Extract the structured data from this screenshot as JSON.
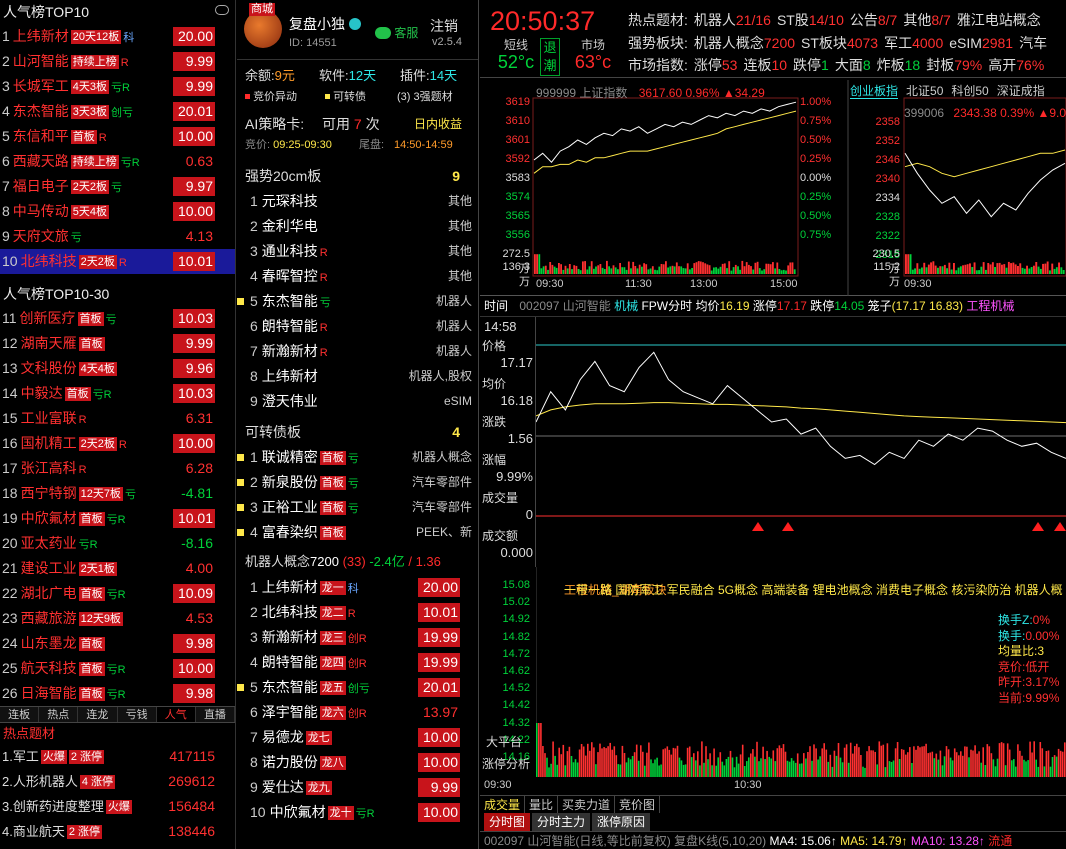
{
  "top10": {
    "title": "人气榜TOP10",
    "rows": [
      {
        "n": "1",
        "name": "上纬新材",
        "tags": [
          "20天12板"
        ],
        "mark": "科",
        "mark_color": "blue",
        "val": "20.00",
        "bg": true
      },
      {
        "n": "2",
        "name": "山河智能",
        "tags": [
          "持续上榜"
        ],
        "mark": "R",
        "mark_color": "red",
        "val": "9.99",
        "bg": true
      },
      {
        "n": "3",
        "name": "长城军工",
        "tags": [
          "4天3板"
        ],
        "mark": "亏R",
        "mark_color": "green",
        "val": "9.99",
        "bg": true
      },
      {
        "n": "4",
        "name": "东杰智能",
        "tags": [
          "3天3板"
        ],
        "mark": "创亏",
        "mark_color": "green",
        "val": "20.01",
        "bg": true
      },
      {
        "n": "5",
        "name": "东信和平",
        "tags": [
          "首板"
        ],
        "mark": "R",
        "mark_color": "red",
        "val": "10.00",
        "bg": true
      },
      {
        "n": "6",
        "name": "西藏天路",
        "tags": [
          "持续上榜"
        ],
        "mark": "亏R",
        "mark_color": "green",
        "val": "0.63",
        "bg": false
      },
      {
        "n": "7",
        "name": "福日电子",
        "tags": [
          "2天2板"
        ],
        "mark": "亏",
        "mark_color": "green",
        "val": "9.97",
        "bg": true
      },
      {
        "n": "8",
        "name": "中马传动",
        "tags": [
          "5天4板"
        ],
        "mark": "",
        "mark_color": "",
        "val": "10.00",
        "bg": true
      },
      {
        "n": "9",
        "name": "天府文旅",
        "tags": [],
        "mark": "亏",
        "mark_color": "green",
        "val": "4.13",
        "bg": false
      },
      {
        "n": "10",
        "name": "北纬科技",
        "tags": [
          "2天2板"
        ],
        "mark": "R",
        "mark_color": "red",
        "val": "10.01",
        "bg": true,
        "sel": true
      }
    ]
  },
  "top30": {
    "title": "人气榜TOP10-30",
    "rows": [
      {
        "n": "11",
        "name": "创新医疗",
        "tags": [
          "首板"
        ],
        "mark": "亏",
        "mark_color": "green",
        "val": "10.03",
        "bg": true
      },
      {
        "n": "12",
        "name": "湖南天雁",
        "tags": [
          "首板"
        ],
        "mark": "",
        "mark_color": "",
        "val": "9.99",
        "bg": true
      },
      {
        "n": "13",
        "name": "文科股份",
        "tags": [
          "4天4板"
        ],
        "mark": "",
        "mark_color": "",
        "val": "9.96",
        "bg": true
      },
      {
        "n": "14",
        "name": "中毅达",
        "tags": [
          "首板"
        ],
        "mark": "亏R",
        "mark_color": "green",
        "val": "10.03",
        "bg": true
      },
      {
        "n": "15",
        "name": "工业富联",
        "tags": [],
        "mark": "R",
        "mark_color": "red",
        "val": "6.31",
        "bg": false
      },
      {
        "n": "16",
        "name": "国机精工",
        "tags": [
          "2天2板"
        ],
        "mark": "R",
        "mark_color": "red",
        "val": "10.00",
        "bg": true
      },
      {
        "n": "17",
        "name": "张江高科",
        "tags": [],
        "mark": "R",
        "mark_color": "red",
        "val": "6.28",
        "bg": false
      },
      {
        "n": "18",
        "name": "西宁特钢",
        "tags": [
          "12天7板"
        ],
        "mark": "亏",
        "mark_color": "green",
        "val": "-4.81",
        "bg": false,
        "neg": true
      },
      {
        "n": "19",
        "name": "中欣氟材",
        "tags": [
          "首板"
        ],
        "mark": "亏R",
        "mark_color": "green",
        "val": "10.01",
        "bg": true
      },
      {
        "n": "20",
        "name": "亚太药业",
        "tags": [],
        "mark": "亏R",
        "mark_color": "green",
        "val": "-8.16",
        "bg": false,
        "neg": true
      },
      {
        "n": "21",
        "name": "建设工业",
        "tags": [
          "2天1板"
        ],
        "mark": "",
        "mark_color": "",
        "val": "4.00",
        "bg": false
      },
      {
        "n": "22",
        "name": "湖北广电",
        "tags": [
          "首板"
        ],
        "mark": "亏R",
        "mark_color": "green",
        "val": "10.09",
        "bg": true
      },
      {
        "n": "23",
        "name": "西藏旅游",
        "tags": [
          "12天9板"
        ],
        "mark": "",
        "mark_color": "",
        "val": "4.53",
        "bg": false
      },
      {
        "n": "24",
        "name": "山东墨龙",
        "tags": [
          "首板"
        ],
        "mark": "",
        "mark_color": "",
        "val": "9.98",
        "bg": true
      },
      {
        "n": "25",
        "name": "航天科技",
        "tags": [
          "首板"
        ],
        "mark": "亏R",
        "mark_color": "green",
        "val": "10.00",
        "bg": true
      },
      {
        "n": "26",
        "name": "日海智能",
        "tags": [
          "首板"
        ],
        "mark": "亏R",
        "mark_color": "green",
        "val": "9.98",
        "bg": true
      }
    ]
  },
  "left_tabs": [
    "连板",
    "热点",
    "连龙",
    "亏钱",
    "人气",
    "直播"
  ],
  "left_tab_active": 4,
  "hot": {
    "title": "热点题材",
    "rows": [
      {
        "n": "1.",
        "name": "军工",
        "tags": [
          "火爆",
          "2 涨停"
        ],
        "val": "417115"
      },
      {
        "n": "2.",
        "name": "人形机器人",
        "tags": [
          "4 涨停"
        ],
        "val": "269612"
      },
      {
        "n": "3.",
        "name": "创新药进度整理",
        "tags": [
          "火爆"
        ],
        "val": "156484"
      },
      {
        "n": "4.",
        "name": "商业航天",
        "tags": [
          "2 涨停"
        ],
        "val": "138446"
      }
    ]
  },
  "user": {
    "shop": "商城",
    "name": "复盘小独",
    "id": "ID: 14551",
    "service": "客服",
    "logout": "注销",
    "version": "v2.5.4",
    "balance_label": "余额:",
    "balance": "9元",
    "soft_label": "软件:",
    "soft": "12天",
    "plugin_label": "插件:",
    "plugin": "14天",
    "opt1": "竞价异动",
    "opt2": "可转债",
    "opt3": "(3) 3强题材"
  },
  "ai": {
    "title": "AI策略卡:",
    "can_label": "可用",
    "can": "7",
    "unit": "次",
    "mode": "日内收益",
    "bid_label": "竞价:",
    "bid": "09:25-09:30",
    "tail_label": "尾盘:",
    "tail": "14:50-14:59"
  },
  "strong": {
    "title": "强势20cm板",
    "count": "9",
    "rows": [
      {
        "n": "1",
        "name": "元琛科技",
        "sq": false,
        "mark": "",
        "rt": "其他"
      },
      {
        "n": "2",
        "name": "金利华电",
        "sq": false,
        "mark": "",
        "rt": "其他"
      },
      {
        "n": "3",
        "name": "通业科技",
        "sq": false,
        "mark": "R",
        "rt": "其他"
      },
      {
        "n": "4",
        "name": "春晖智控",
        "sq": false,
        "mark": "R",
        "rt": "其他"
      },
      {
        "n": "5",
        "name": "东杰智能",
        "sq": true,
        "mark": "亏",
        "rt": "机器人"
      },
      {
        "n": "6",
        "name": "朗特智能",
        "sq": false,
        "mark": "R",
        "rt": "机器人"
      },
      {
        "n": "7",
        "name": "新瀚新材",
        "sq": false,
        "mark": "R",
        "rt": "机器人"
      },
      {
        "n": "8",
        "name": "上纬新材",
        "sq": false,
        "mark": "",
        "rt": "机器人,股权"
      },
      {
        "n": "9",
        "name": "澄天伟业",
        "sq": false,
        "mark": "",
        "rt": "eSIM"
      }
    ]
  },
  "bonds": {
    "title": "可转债板",
    "count": "4",
    "rows": [
      {
        "n": "1",
        "name": "联诚精密",
        "tag": "首板",
        "mark": "亏",
        "rt": "机器人概念"
      },
      {
        "n": "2",
        "name": "新泉股份",
        "tag": "首板",
        "mark": "亏",
        "rt": "汽车零部件"
      },
      {
        "n": "3",
        "name": "正裕工业",
        "tag": "首板",
        "mark": "亏",
        "rt": "汽车零部件"
      },
      {
        "n": "4",
        "name": "富春染织",
        "tag": "首板",
        "mark": "",
        "rt": "PEEK、新"
      }
    ]
  },
  "robot": {
    "title": "机器人概念",
    "index": "7200",
    "sub": "(33)",
    "chg": "-2.4亿",
    "ratio": "/ 1.36",
    "rows": [
      {
        "n": "1",
        "name": "上纬新材",
        "tag": "龙一",
        "mark": "科",
        "sq": false,
        "val": "20.00",
        "bg": true
      },
      {
        "n": "2",
        "name": "北纬科技",
        "tag": "龙二",
        "mark": "R",
        "sq": false,
        "val": "10.01",
        "bg": true
      },
      {
        "n": "3",
        "name": "新瀚新材",
        "tag": "龙三",
        "mark": "创R",
        "sq": false,
        "val": "19.99",
        "bg": true
      },
      {
        "n": "4",
        "name": "朗特智能",
        "tag": "龙四",
        "mark": "创R",
        "sq": false,
        "val": "19.99",
        "bg": true
      },
      {
        "n": "5",
        "name": "东杰智能",
        "tag": "龙五",
        "mark": "创亏",
        "sq": true,
        "val": "20.01",
        "bg": true
      },
      {
        "n": "6",
        "name": "泽宇智能",
        "tag": "龙六",
        "mark": "创R",
        "sq": false,
        "val": "13.97",
        "bg": false
      },
      {
        "n": "7",
        "name": "易德龙",
        "tag": "龙七",
        "mark": "",
        "sq": false,
        "val": "10.00",
        "bg": true
      },
      {
        "n": "8",
        "name": "诺力股份",
        "tag": "龙八",
        "mark": "",
        "sq": false,
        "val": "10.00",
        "bg": true
      },
      {
        "n": "9",
        "name": "爱仕达",
        "tag": "龙九",
        "mark": "",
        "sq": false,
        "val": "9.99",
        "bg": true
      },
      {
        "n": "10",
        "name": "中欣氟材",
        "tag": "龙十",
        "mark": "亏R",
        "sq": false,
        "val": "10.00",
        "bg": true
      }
    ]
  },
  "status": {
    "time": "20:50:37",
    "short_label": "短线",
    "short_temp": "52°c",
    "retreat": "退潮",
    "market_label": "市场",
    "market_temp": "63°c",
    "hot_label": "热点题材:",
    "hot_items": [
      {
        "k": "机器人",
        "v": "21/16"
      },
      {
        "k": "ST股",
        "v": "14/10"
      },
      {
        "k": "公告",
        "v": "8/7"
      },
      {
        "k": "其他",
        "v": "8/7"
      },
      {
        "k": "雅江电站概念",
        "v": ""
      }
    ],
    "strong_label": "强势板块:",
    "strong_items": [
      {
        "k": "机器人概念",
        "v": "7200"
      },
      {
        "k": "ST板块",
        "v": "4073"
      },
      {
        "k": "军工",
        "v": "4000"
      },
      {
        "k": "eSIM",
        "v": "2981"
      },
      {
        "k": "汽车",
        "v": ""
      }
    ],
    "index_label": "市场指数:",
    "index_items": [
      {
        "k": "涨停",
        "v": "53",
        "c": "red"
      },
      {
        "k": "连板",
        "v": "10",
        "c": "red"
      },
      {
        "k": "跌停",
        "v": "1",
        "c": "green"
      },
      {
        "k": "大面",
        "v": "8",
        "c": "green"
      },
      {
        "k": "炸板",
        "v": "18",
        "c": "green"
      },
      {
        "k": "封板",
        "v": "79%",
        "c": "red"
      },
      {
        "k": "高开",
        "v": "76%",
        "c": "red"
      }
    ]
  },
  "index_sh": {
    "code": "999999",
    "name": "上证指数",
    "price": "3617.60",
    "pct": "0.96%",
    "chg": "▲34.29",
    "left_ticks": [
      "3619",
      "3610",
      "3601",
      "3592",
      "3583",
      "3574",
      "3565",
      "3556"
    ],
    "right_ticks": [
      "1.00%",
      "0.75%",
      "0.50%",
      "0.25%",
      "0.00%",
      "0.25%",
      "0.50%",
      "0.75%"
    ],
    "vol_ticks": [
      "272.5万",
      "136.3万"
    ],
    "times": [
      "09:30",
      "11:30",
      "13:00",
      "15:00"
    ]
  },
  "index_cy": {
    "tabs": [
      "创业板指",
      "北证50",
      "科创50",
      "深证成指"
    ],
    "code": "399006",
    "price": "2343.38",
    "pct": "0.39%",
    "chg": "▲9.0",
    "left_ticks": [
      "2358",
      "2352",
      "2346",
      "2340",
      "2334",
      "2328",
      "2322",
      "2316"
    ],
    "vol_ticks": [
      "230.5万",
      "115.2万"
    ],
    "times": [
      "09:30"
    ]
  },
  "stock": {
    "hdr": {
      "t": "时间",
      "code": "002097",
      "name": "山河智能",
      "ind": "机械",
      "fpw": "FPW分时",
      "avg_label": "均价",
      "avg": "16.19",
      "zt_label": "涨停",
      "zt": "17.17",
      "dt_label": "跌停",
      "dt": "14.05",
      "cage_label": "笼子",
      "cage": "(17.17 16.83)",
      "extra": "工程机械"
    },
    "side": {
      "time": "14:58",
      "price_label": "价格",
      "price": "17.17",
      "avg_label": "均价",
      "avg": "16.18",
      "chg_label": "涨跌",
      "chg": "1.56",
      "pct_label": "涨幅",
      "pct": "9.99%",
      "vol_label": "成交量",
      "vol": "0",
      "amt_label": "成交额",
      "amt": "0.000"
    },
    "concept": "工程机械_湖南板块",
    "concepts": "一带一路 国防军工 军民融合 5G概念 高端装备 锂电池概念 消费电子概念 核污染防治 机器人概",
    "lower_ticks": [
      "15.08",
      "15.02",
      "14.92",
      "14.82",
      "14.72",
      "14.62",
      "14.52",
      "14.42",
      "14.32",
      "14.22",
      "14.16"
    ],
    "info": [
      {
        "k": "换手Z:",
        "v": "0%"
      },
      {
        "k": "换手:",
        "v": "0.00%"
      },
      {
        "k": "均量比:",
        "v": "3"
      },
      {
        "k": "竞价:",
        "v": "低开"
      },
      {
        "k": "昨开:",
        "v": "3.17%"
      },
      {
        "k": "当前:",
        "v": "9.99%"
      }
    ],
    "bigplat": "大平台",
    "zt_analysis": "涨停分析",
    "times": [
      "09:30",
      "10:30"
    ],
    "tabs1": [
      "成交量",
      "量比",
      "买卖力道",
      "竞价图"
    ],
    "tabs2": [
      "分时图",
      "分时主力",
      "涨停原因"
    ],
    "kline": {
      "code": "002097",
      "name": "山河智能(日线,等比前复权)",
      "ind": "复盘K线(5,10,20)",
      "ma4": "MA4: 15.06↑",
      "ma5": "MA5: 14.79↑",
      "ma10": "MA10: 13.28↑",
      "flow": "流通"
    }
  },
  "chart_data": [
    {
      "type": "line",
      "title": "999999 上证指数",
      "ylim": [
        3556,
        3619
      ],
      "series": [
        {
          "name": "上证指数",
          "values": [
            3592,
            3595,
            3591,
            3596,
            3598,
            3601,
            3599,
            3602,
            3604,
            3603,
            3606,
            3605,
            3607,
            3604,
            3606,
            3608,
            3607,
            3609,
            3608,
            3610,
            3612,
            3611,
            3613,
            3612,
            3614,
            3613,
            3615,
            3614,
            3616,
            3617,
            3618
          ]
        },
        {
          "name": "均线",
          "values": [
            3586,
            3589,
            3589,
            3590,
            3590,
            3592,
            3591,
            3593,
            3593,
            3594,
            3595,
            3596,
            3596,
            3596,
            3597,
            3598,
            3599,
            3600,
            3601,
            3602,
            3603,
            3604,
            3606,
            3607,
            3608,
            3609,
            3610,
            3611,
            3612,
            3613,
            3614
          ]
        }
      ]
    },
    {
      "type": "line",
      "title": "399006",
      "ylim": [
        2316,
        2358
      ],
      "series": [
        {
          "name": "创业板指",
          "values": [
            2348,
            2342,
            2337,
            2333,
            2335,
            2330,
            2334,
            2329,
            2333,
            2331,
            2336,
            2340,
            2343,
            2345
          ]
        },
        {
          "name": "均线",
          "values": [
            2344,
            2345,
            2344,
            2342,
            2341,
            2342,
            2343,
            2344,
            2345,
            2346,
            2347,
            2348,
            2348,
            2349
          ]
        }
      ]
    },
    {
      "type": "line",
      "title": "002097 山河智能",
      "ylim": [
        14.05,
        17.17
      ],
      "series": [
        {
          "name": "价格",
          "values": [
            15.9,
            16.4,
            16.1,
            16.6,
            16.9,
            16.5,
            16.4,
            16.8,
            17.05,
            16.6,
            16.4,
            16.3,
            16.2,
            16.5,
            16.3,
            16.1,
            15.9,
            15.95,
            15.7,
            15.8,
            15.5,
            15.3,
            15.35,
            15.2,
            15.4,
            15.3,
            15.6,
            15.5,
            15.7,
            15.6,
            15.8,
            15.75,
            15.6,
            15.5,
            15.55,
            15.4,
            15.3
          ]
        },
        {
          "name": "均价",
          "values": [
            16.0,
            16.1,
            16.15,
            16.18,
            16.2,
            16.2,
            16.2,
            16.21,
            16.22,
            16.22,
            16.21,
            16.2,
            16.19,
            16.19,
            16.18,
            16.17,
            16.16,
            16.15,
            16.13,
            16.12,
            16.1,
            16.08,
            16.06,
            16.04,
            16.02,
            16.0,
            15.99,
            15.98,
            15.97,
            15.96,
            15.95,
            15.94,
            15.93,
            15.92,
            15.91,
            15.9,
            15.89
          ]
        }
      ]
    }
  ]
}
